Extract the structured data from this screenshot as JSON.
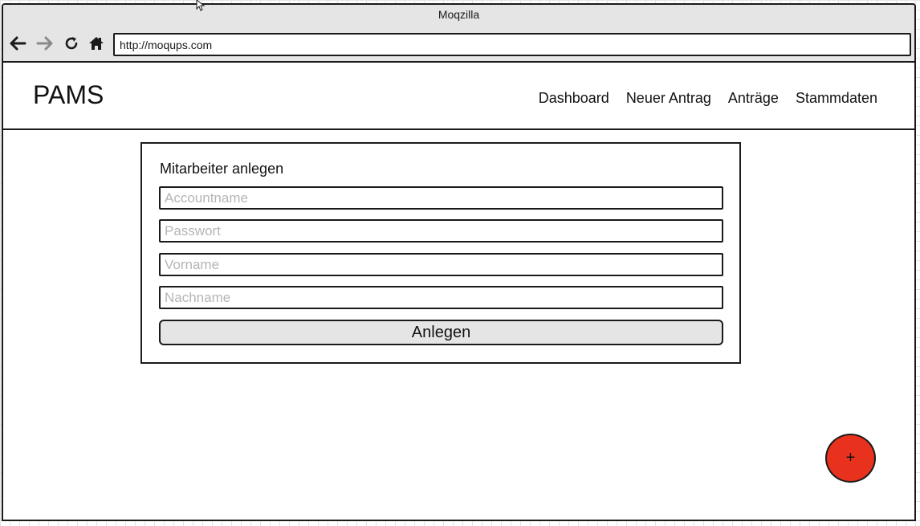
{
  "browser": {
    "window_title": "Moqzilla",
    "address": "http://moqups.com",
    "icons": {
      "back": "arrow-left-icon",
      "forward": "arrow-right-icon",
      "reload": "reload-icon",
      "home": "home-icon"
    }
  },
  "app": {
    "brand": "PAMS",
    "nav": [
      {
        "label": "Dashboard"
      },
      {
        "label": "Neuer Antrag"
      },
      {
        "label": "Anträge"
      },
      {
        "label": "Stammdaten"
      }
    ]
  },
  "form": {
    "title": "Mitarbeiter anlegen",
    "fields": [
      {
        "placeholder": "Accountname",
        "value": ""
      },
      {
        "placeholder": "Passwort",
        "value": ""
      },
      {
        "placeholder": "Vorname",
        "value": ""
      },
      {
        "placeholder": "Nachname",
        "value": ""
      }
    ],
    "submit_label": "Anlegen"
  },
  "fab": {
    "label": "+",
    "color": "#e8321e"
  }
}
